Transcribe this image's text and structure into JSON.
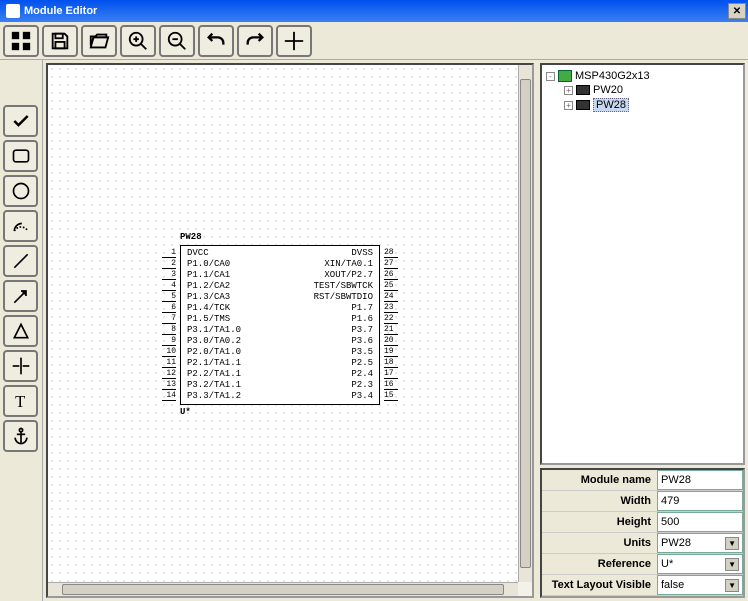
{
  "window": {
    "title": "Module Editor"
  },
  "toolbar": [
    {
      "name": "grid-view-icon"
    },
    {
      "name": "save-icon"
    },
    {
      "name": "open-icon"
    },
    {
      "name": "zoom-in-icon"
    },
    {
      "name": "zoom-out-icon"
    },
    {
      "name": "undo-icon"
    },
    {
      "name": "redo-icon"
    },
    {
      "name": "crosshair-icon"
    }
  ],
  "sidetools": [
    {
      "name": "check-icon"
    },
    {
      "name": "rect-icon"
    },
    {
      "name": "circle-icon"
    },
    {
      "name": "arc-icon"
    },
    {
      "name": "line-icon"
    },
    {
      "name": "arrow-icon"
    },
    {
      "name": "triangle-icon"
    },
    {
      "name": "pin-icon"
    },
    {
      "name": "text-icon"
    },
    {
      "name": "anchor-icon"
    }
  ],
  "chip": {
    "label": "PW28",
    "reference": "U*",
    "pins_left": [
      {
        "num": "1",
        "name": "DVCC"
      },
      {
        "num": "2",
        "name": "P1.0/CA0"
      },
      {
        "num": "3",
        "name": "P1.1/CA1"
      },
      {
        "num": "4",
        "name": "P1.2/CA2"
      },
      {
        "num": "5",
        "name": "P1.3/CA3"
      },
      {
        "num": "6",
        "name": "P1.4/TCK"
      },
      {
        "num": "7",
        "name": "P1.5/TMS"
      },
      {
        "num": "8",
        "name": "P3.1/TA1.0"
      },
      {
        "num": "9",
        "name": "P3.0/TA0.2"
      },
      {
        "num": "10",
        "name": "P2.0/TA1.0"
      },
      {
        "num": "11",
        "name": "P2.1/TA1.1"
      },
      {
        "num": "12",
        "name": "P2.2/TA1.1"
      },
      {
        "num": "13",
        "name": "P3.2/TA1.1"
      },
      {
        "num": "14",
        "name": "P3.3/TA1.2"
      }
    ],
    "pins_right": [
      {
        "num": "28",
        "name": "DVSS"
      },
      {
        "num": "27",
        "name": "XIN/TA0.1"
      },
      {
        "num": "26",
        "name": "XOUT/P2.7"
      },
      {
        "num": "25",
        "name": "TEST/SBWTCK"
      },
      {
        "num": "24",
        "name": "RST/SBWTDIO"
      },
      {
        "num": "23",
        "name": "P1.7"
      },
      {
        "num": "22",
        "name": "P1.6"
      },
      {
        "num": "21",
        "name": "P3.7"
      },
      {
        "num": "20",
        "name": "P3.6"
      },
      {
        "num": "19",
        "name": "P3.5"
      },
      {
        "num": "18",
        "name": "P2.5"
      },
      {
        "num": "17",
        "name": "P2.4"
      },
      {
        "num": "16",
        "name": "P2.3"
      },
      {
        "num": "15",
        "name": "P3.4"
      }
    ]
  },
  "tree": {
    "root": "MSP430G2x13",
    "children": [
      "PW20",
      "PW28"
    ],
    "selected": "PW28"
  },
  "props": {
    "module_name": {
      "label": "Module name",
      "value": "PW28"
    },
    "width": {
      "label": "Width",
      "value": "479"
    },
    "height": {
      "label": "Height",
      "value": "500"
    },
    "units": {
      "label": "Units",
      "value": "PW28"
    },
    "reference": {
      "label": "Reference",
      "value": "U*"
    },
    "text_layout": {
      "label": "Text Layout Visible",
      "value": "false"
    }
  }
}
